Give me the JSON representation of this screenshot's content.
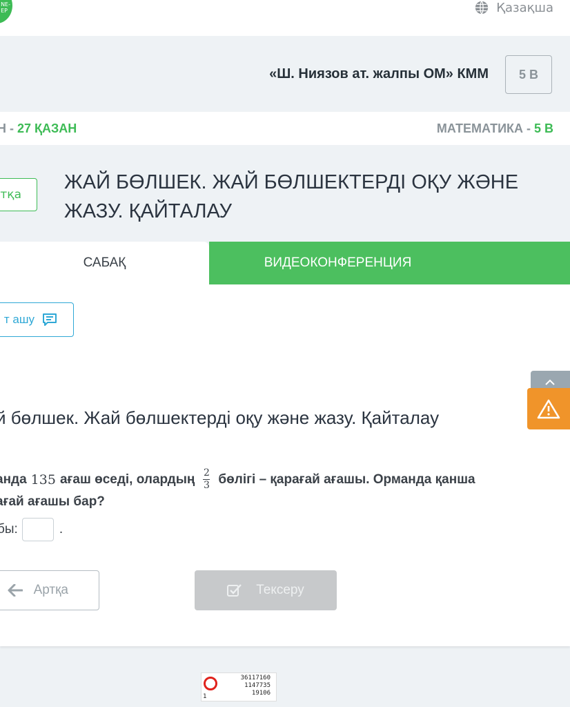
{
  "header": {
    "logo_text": "NE-\nEP",
    "language": "Қазақша",
    "school_name": "«Ш. Ниязов ат. жалпы ОМ» КММ",
    "class_badge": "5 В"
  },
  "datebar": {
    "day_fragment": "Н - ",
    "date": "27 ҚАЗАН",
    "subject": "МАТЕМАТИКА - ",
    "class": "5 В"
  },
  "lesson": {
    "back_label": "ртқа",
    "title": "ЖАЙ БӨЛШЕК. ЖАЙ БӨЛШЕКТЕРДІ ОҚУ ЖӘНЕ ЖАЗУ. ҚАЙТАЛАУ"
  },
  "tabs": [
    {
      "label": "САБАҚ",
      "active": true
    },
    {
      "label": "ВИДЕОКОНФЕРЕНЦИЯ",
      "active": false
    }
  ],
  "chat": {
    "label": "т ашу"
  },
  "task": {
    "title": "й бөлшек. Жай бөлшектерді оқу және жазу. Қайталау",
    "q_part1": "анда ",
    "q_number": "135",
    "q_part2": " ағаш өседі, олардың",
    "frac_num": "2",
    "frac_den": "3",
    "q_part3": "бөлігі – қарағай ағашы. Орманда қанша",
    "q_line2": "ағай ағашы бар?",
    "answer_label": "бы:",
    "answer_value": "",
    "answer_dot": "."
  },
  "buttons": {
    "back": "Артқа",
    "check": "Тексеру"
  },
  "stamp": {
    "line1": "36117160",
    "line2": "1147735",
    "line3": "19106",
    "corner": "1"
  },
  "colors": {
    "green": "#3dbb55",
    "blue": "#2fa8d6",
    "warning": "#f0942a"
  }
}
